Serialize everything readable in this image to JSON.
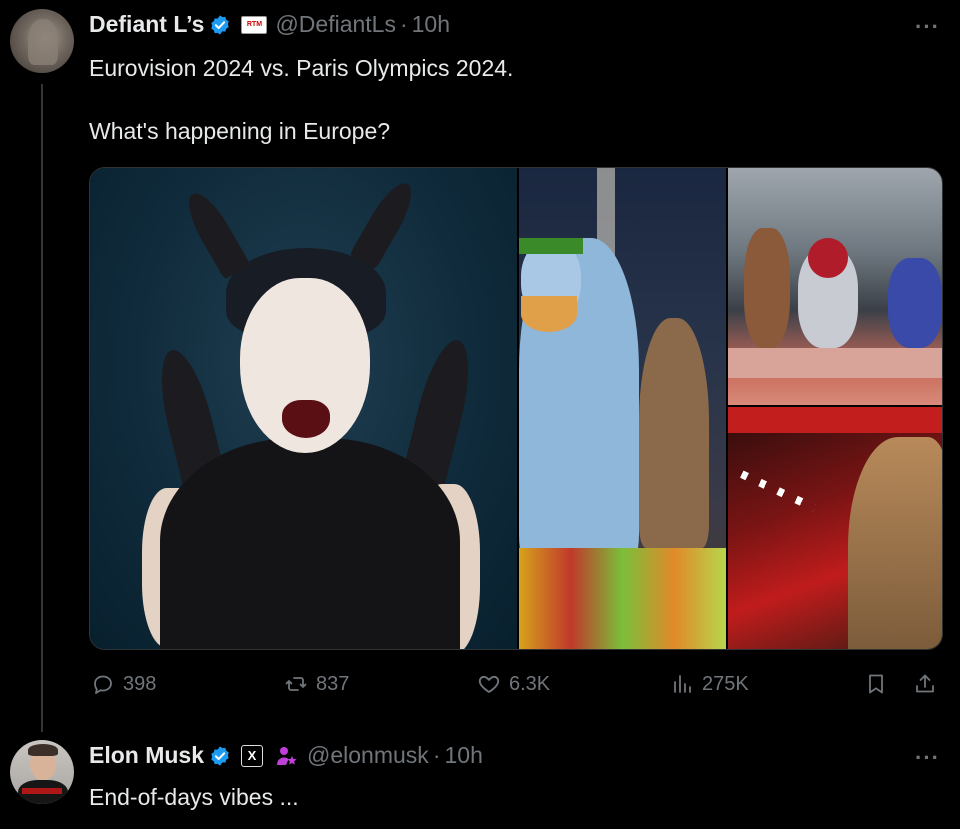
{
  "tweet1": {
    "author_name": "Defiant L’s",
    "affiliation_badge_text": "RTM",
    "handle": "@DefiantLs",
    "separator": "·",
    "time": "10h",
    "text_line1": "Eurovision 2024 vs. Paris Olympics 2024.",
    "text_line2": "What's happening in Europe?",
    "more_label": "···",
    "stats": {
      "replies": "398",
      "reposts": "837",
      "likes": "6.3K",
      "views": "275K"
    }
  },
  "tweet2": {
    "author_name": "Elon Musk",
    "affiliation_badge_text": "X",
    "handle": "@elonmusk",
    "separator": "·",
    "time": "10h",
    "text_line1": "End-of-days vibes ...",
    "more_label": "···"
  },
  "colors": {
    "background": "#000000",
    "text": "#e7e9ea",
    "muted": "#71767b",
    "verified": "#1d9bf0",
    "gov_icon": "#c03fd8"
  },
  "icons": [
    "verified-badge-icon",
    "reply-icon",
    "repost-icon",
    "like-icon",
    "views-icon",
    "bookmark-icon",
    "share-icon",
    "government-official-icon"
  ]
}
